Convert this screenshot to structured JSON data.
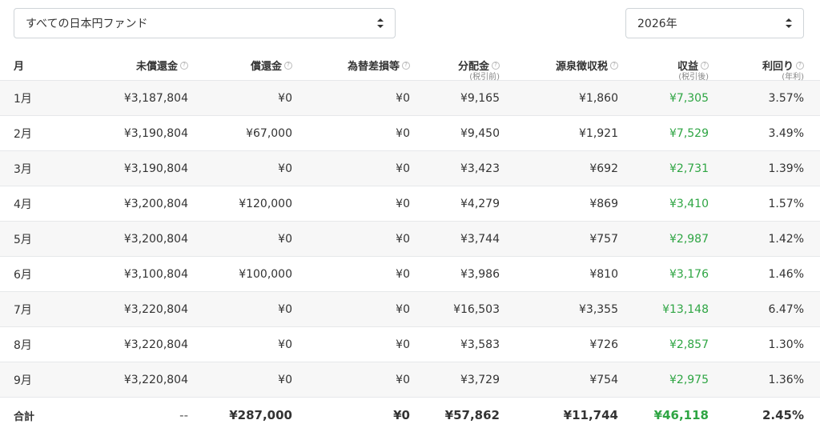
{
  "filters": {
    "fund": "すべての日本円ファンド",
    "year": "2026年"
  },
  "headers": {
    "month": "月",
    "unredeemed": "未償還金",
    "redemption": "償還金",
    "fx": "為替差損等",
    "distribution": "分配金",
    "distribution_sub": "(税引前)",
    "withholding": "源泉徴収税",
    "profit": "収益",
    "profit_sub": "(税引後)",
    "yield": "利回り",
    "yield_sub": "(年利)"
  },
  "rows": [
    {
      "month": "1月",
      "unredeemed": "¥3,187,804",
      "redemption": "¥0",
      "fx": "¥0",
      "distribution": "¥9,165",
      "withholding": "¥1,860",
      "profit": "¥7,305",
      "yield": "3.57%"
    },
    {
      "month": "2月",
      "unredeemed": "¥3,190,804",
      "redemption": "¥67,000",
      "fx": "¥0",
      "distribution": "¥9,450",
      "withholding": "¥1,921",
      "profit": "¥7,529",
      "yield": "3.49%"
    },
    {
      "month": "3月",
      "unredeemed": "¥3,190,804",
      "redemption": "¥0",
      "fx": "¥0",
      "distribution": "¥3,423",
      "withholding": "¥692",
      "profit": "¥2,731",
      "yield": "1.39%"
    },
    {
      "month": "4月",
      "unredeemed": "¥3,200,804",
      "redemption": "¥120,000",
      "fx": "¥0",
      "distribution": "¥4,279",
      "withholding": "¥869",
      "profit": "¥3,410",
      "yield": "1.57%"
    },
    {
      "month": "5月",
      "unredeemed": "¥3,200,804",
      "redemption": "¥0",
      "fx": "¥0",
      "distribution": "¥3,744",
      "withholding": "¥757",
      "profit": "¥2,987",
      "yield": "1.42%"
    },
    {
      "month": "6月",
      "unredeemed": "¥3,100,804",
      "redemption": "¥100,000",
      "fx": "¥0",
      "distribution": "¥3,986",
      "withholding": "¥810",
      "profit": "¥3,176",
      "yield": "1.46%"
    },
    {
      "month": "7月",
      "unredeemed": "¥3,220,804",
      "redemption": "¥0",
      "fx": "¥0",
      "distribution": "¥16,503",
      "withholding": "¥3,355",
      "profit": "¥13,148",
      "yield": "6.47%"
    },
    {
      "month": "8月",
      "unredeemed": "¥3,220,804",
      "redemption": "¥0",
      "fx": "¥0",
      "distribution": "¥3,583",
      "withholding": "¥726",
      "profit": "¥2,857",
      "yield": "1.30%"
    },
    {
      "month": "9月",
      "unredeemed": "¥3,220,804",
      "redemption": "¥0",
      "fx": "¥0",
      "distribution": "¥3,729",
      "withholding": "¥754",
      "profit": "¥2,975",
      "yield": "1.36%"
    }
  ],
  "total": {
    "label": "合計",
    "unredeemed": "--",
    "redemption": "¥287,000",
    "fx": "¥0",
    "distribution": "¥57,862",
    "withholding": "¥11,744",
    "profit": "¥46,118",
    "yield": "2.45%"
  },
  "colors": {
    "profit": "#2ea543",
    "row_alt": "#f7f7f7"
  },
  "icons": {
    "info": "?"
  }
}
